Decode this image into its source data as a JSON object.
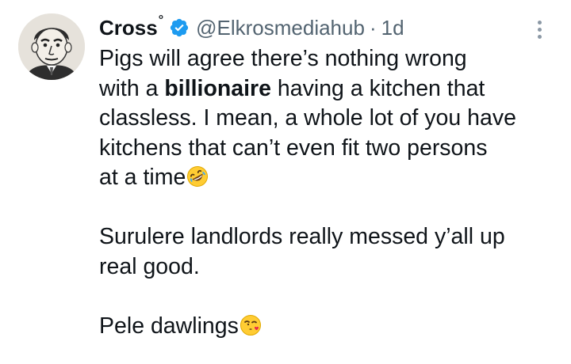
{
  "author": {
    "display_name": "Cross",
    "name_mark": "°",
    "handle": "@Elkrosmediahub",
    "separator": "·",
    "time": "1d",
    "verified": true,
    "verified_color": "#1d9bf0"
  },
  "tweet": {
    "para1": {
      "line1": "Pigs will agree there’s nothing wrong",
      "line2_before": "with a ",
      "line2_bold": "billionaire",
      "line2_after": " having a kitchen that",
      "line3": "classless. I mean, a whole lot of you have",
      "line4": "kitchens that can’t even fit two persons",
      "line5": "at a time"
    },
    "para2": {
      "line1": "Surulere landlords really messed y’all up",
      "line2": "real good."
    },
    "para3": {
      "line1": "Pele dawlings"
    }
  },
  "icons": {
    "verified": "verified-badge-icon",
    "more": "more-options-icon",
    "laugh_emoji": "rolling-on-floor-laughing-emoji",
    "kiss_emoji": "face-blowing-kiss-emoji"
  },
  "colors": {
    "text": "#0f1419",
    "secondary": "#536471",
    "accent": "#1d9bf0"
  }
}
